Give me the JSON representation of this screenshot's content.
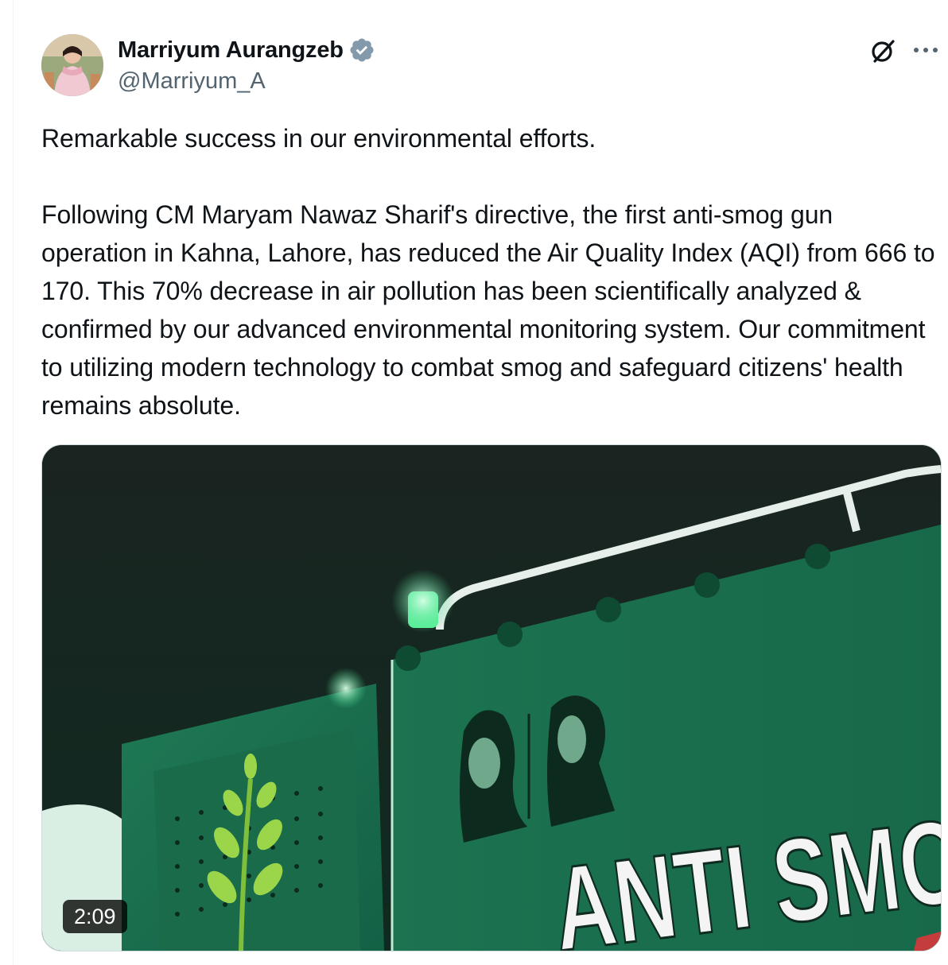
{
  "author": {
    "display_name": "Marriyum Aurangzeb",
    "handle": "@Marriyum_A",
    "verified": true,
    "verified_color": "#829aab",
    "avatar_icon": "profile-photo"
  },
  "actions": {
    "grok_icon": "grok-icon",
    "more_icon": "more-horizontal-icon"
  },
  "tweet": {
    "paragraphs": [
      "Remarkable success in our environmental efforts.",
      "Following CM Maryam Nawaz Sharif's directive, the first anti-smog gun operation in Kahna, Lahore, has reduced the Air Quality Index (AQI) from 666 to 170. This 70% decrease in air pollution has been scientifically analyzed & confirmed by our advanced environmental monitoring system. Our commitment to utilizing modern technology to combat smog and safeguard citizens' health remains absolute."
    ]
  },
  "media": {
    "type": "video",
    "duration": "2:09",
    "sign_text": "ANTI SMO",
    "accent_color": "#1f8a5c"
  }
}
